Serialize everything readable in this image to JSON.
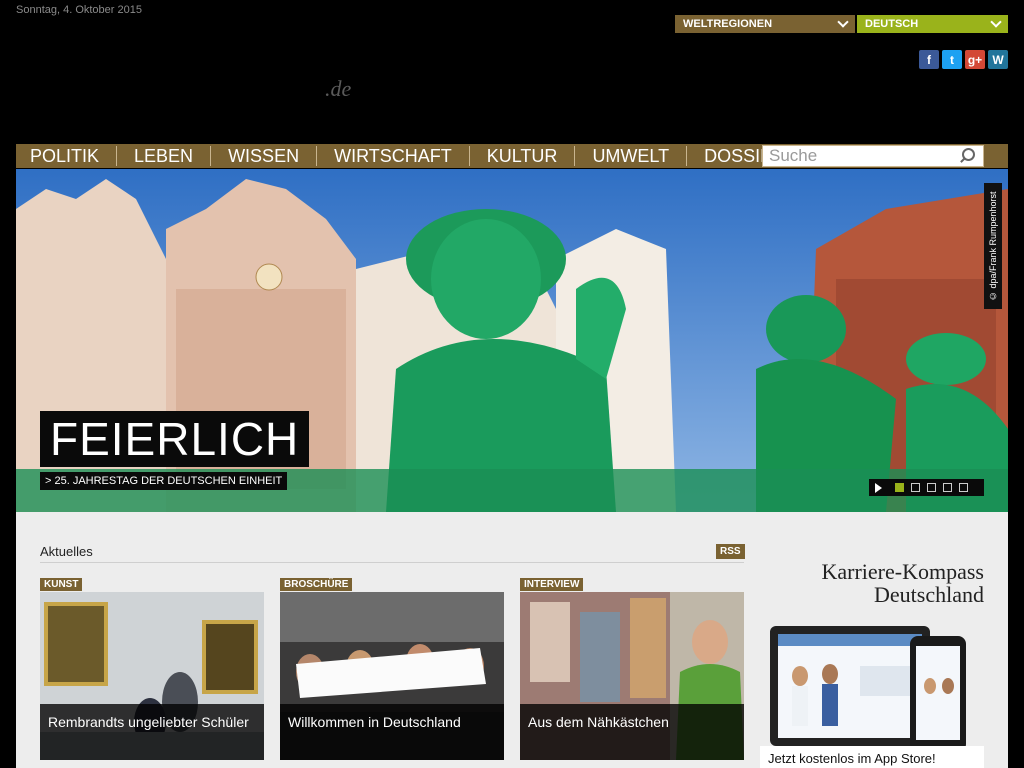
{
  "header": {
    "date": "Sonntag, 4. Oktober 2015",
    "logo_suffix": ".de",
    "regions_label": "WELTREGIONEN",
    "language_label": "DEUTSCH",
    "social": [
      {
        "name": "facebook-icon",
        "glyph": "f"
      },
      {
        "name": "twitter-icon",
        "glyph": "t"
      },
      {
        "name": "google-plus-icon",
        "glyph": "g+"
      },
      {
        "name": "wordpress-icon",
        "glyph": "W"
      }
    ]
  },
  "nav": {
    "items": [
      "POLITIK",
      "LEBEN",
      "WISSEN",
      "WIRTSCHAFT",
      "KULTUR",
      "UMWELT",
      "DOSSIER"
    ],
    "search_placeholder": "Suche"
  },
  "hero": {
    "credit": "© dpa/Frank Rumpenhorst",
    "headline": "FEIERLICH",
    "subheadline": "> 25. JAHRESTAG DER DEUTSCHEN EINHEIT",
    "slides_total": 5,
    "active_slide": 1
  },
  "news": {
    "section_title": "Aktuelles",
    "rss_label": "RSS",
    "cards": [
      {
        "tag": "KUNST",
        "caption": "Rembrandts ungeliebter Schüler"
      },
      {
        "tag": "BROSCHÜRE",
        "caption": "Willkommen in Deutschland"
      },
      {
        "tag": "INTERVIEW",
        "caption": "Aus dem Nähkästchen"
      }
    ]
  },
  "promo": {
    "title_line1": "Karriere-Kompass",
    "title_line2": "Deutschland",
    "cta": "Jetzt kostenlos im App Store!"
  },
  "colors": {
    "brand_brown": "#7a6232",
    "accent_green": "#9ab31b"
  }
}
